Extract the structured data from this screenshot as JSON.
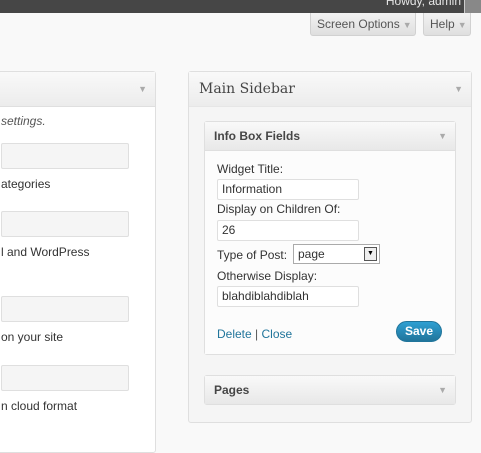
{
  "adminbar": {
    "howdy": "Howdy, admin"
  },
  "tabs": {
    "screen_options": "Screen Options",
    "help": "Help"
  },
  "left_panel": {
    "texts": [
      "settings.",
      "ategories",
      "l and WordPress",
      "on your site",
      "n cloud format"
    ]
  },
  "sidebar": {
    "title": "Main Sidebar",
    "widgets": {
      "info_box": {
        "title": "Info Box Fields",
        "fields": {
          "widget_title_label": "Widget Title:",
          "widget_title_value": "Information",
          "children_label": "Display on Children Of:",
          "children_value": "26",
          "post_type_label": "Type of Post:",
          "post_type_value": "page",
          "otherwise_label": "Otherwise Display:",
          "otherwise_value": "blahdiblahdiblah"
        },
        "delete_label": "Delete",
        "separator": "|",
        "close_label": "Close",
        "save_label": "Save"
      },
      "pages": {
        "title": "Pages"
      }
    }
  }
}
